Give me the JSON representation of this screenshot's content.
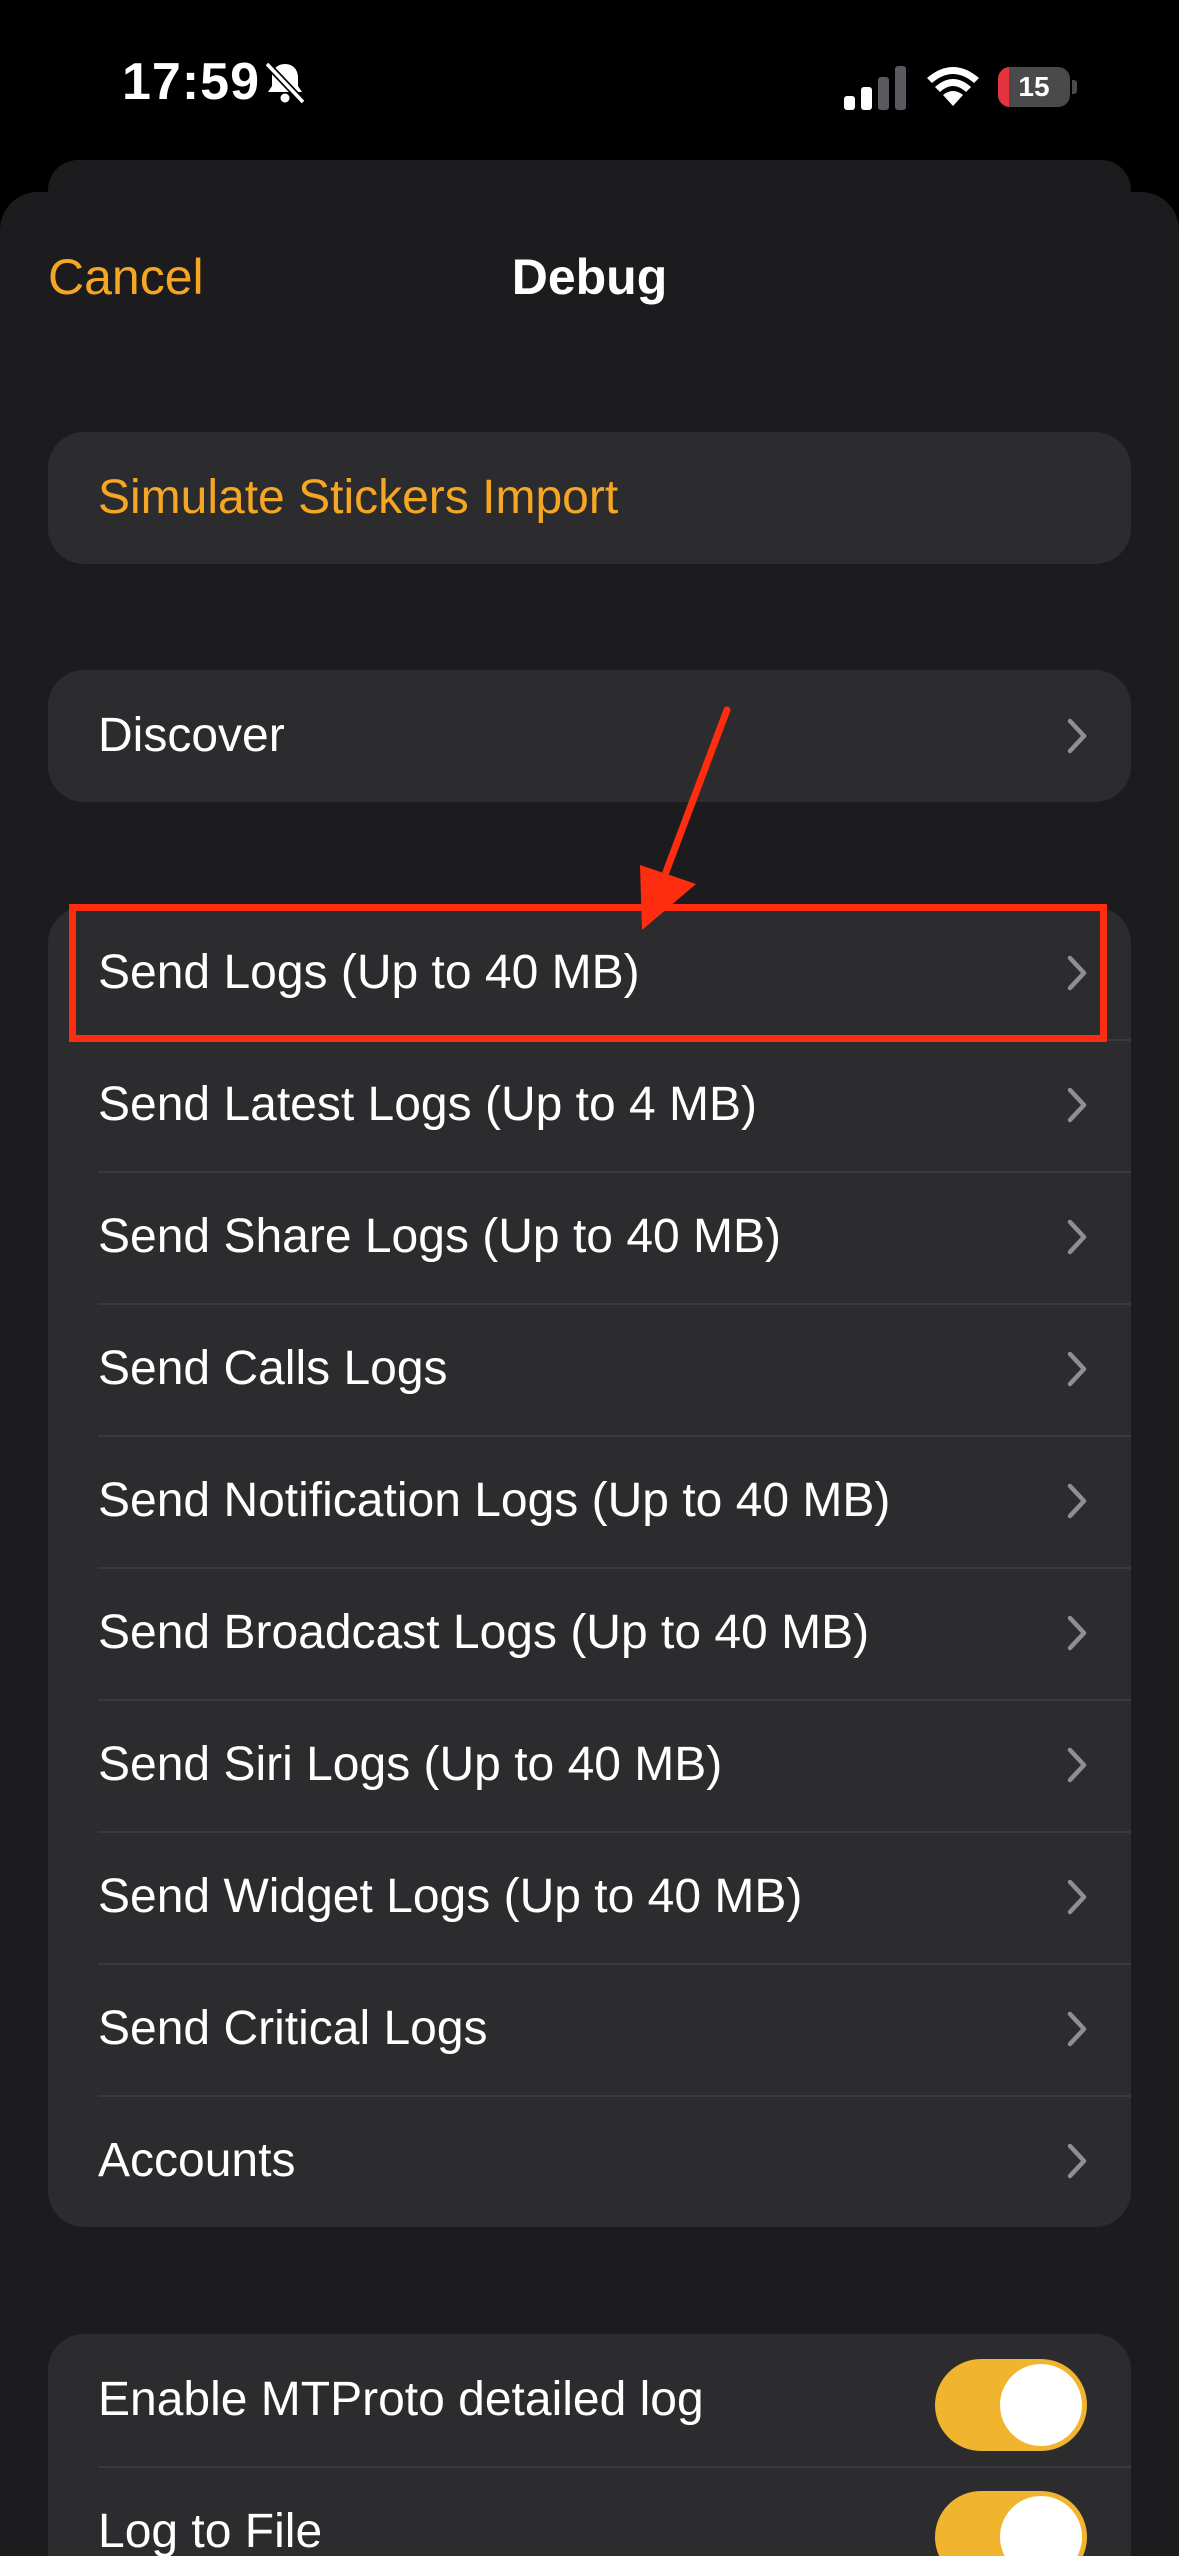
{
  "status_bar": {
    "time": "17:59",
    "battery_level": "15",
    "icons": [
      "bell-slash-icon",
      "signal-icon",
      "wifi-icon",
      "battery-icon"
    ]
  },
  "nav": {
    "cancel_label": "Cancel",
    "title": "Debug"
  },
  "groups": {
    "stickers": {
      "label": "Simulate Stickers Import"
    },
    "discover": {
      "label": "Discover"
    },
    "logs": [
      {
        "label": "Send Logs (Up to 40 MB)"
      },
      {
        "label": "Send Latest Logs (Up to 4 MB)"
      },
      {
        "label": "Send Share Logs (Up to 40 MB)"
      },
      {
        "label": "Send Calls Logs"
      },
      {
        "label": "Send Notification Logs (Up to 40 MB)"
      },
      {
        "label": "Send Broadcast Logs (Up to 40 MB)"
      },
      {
        "label": "Send Siri Logs (Up to 40 MB)"
      },
      {
        "label": "Send Widget Logs (Up to 40 MB)"
      },
      {
        "label": "Send Critical Logs"
      },
      {
        "label": "Accounts"
      }
    ],
    "toggles": [
      {
        "label": "Enable MTProto detailed log",
        "on": true
      },
      {
        "label": "Log to File",
        "on": true
      }
    ]
  },
  "colors": {
    "accent": "#f5a623",
    "toggle_on": "#f1b42f",
    "annotation": "#ff2d10"
  }
}
